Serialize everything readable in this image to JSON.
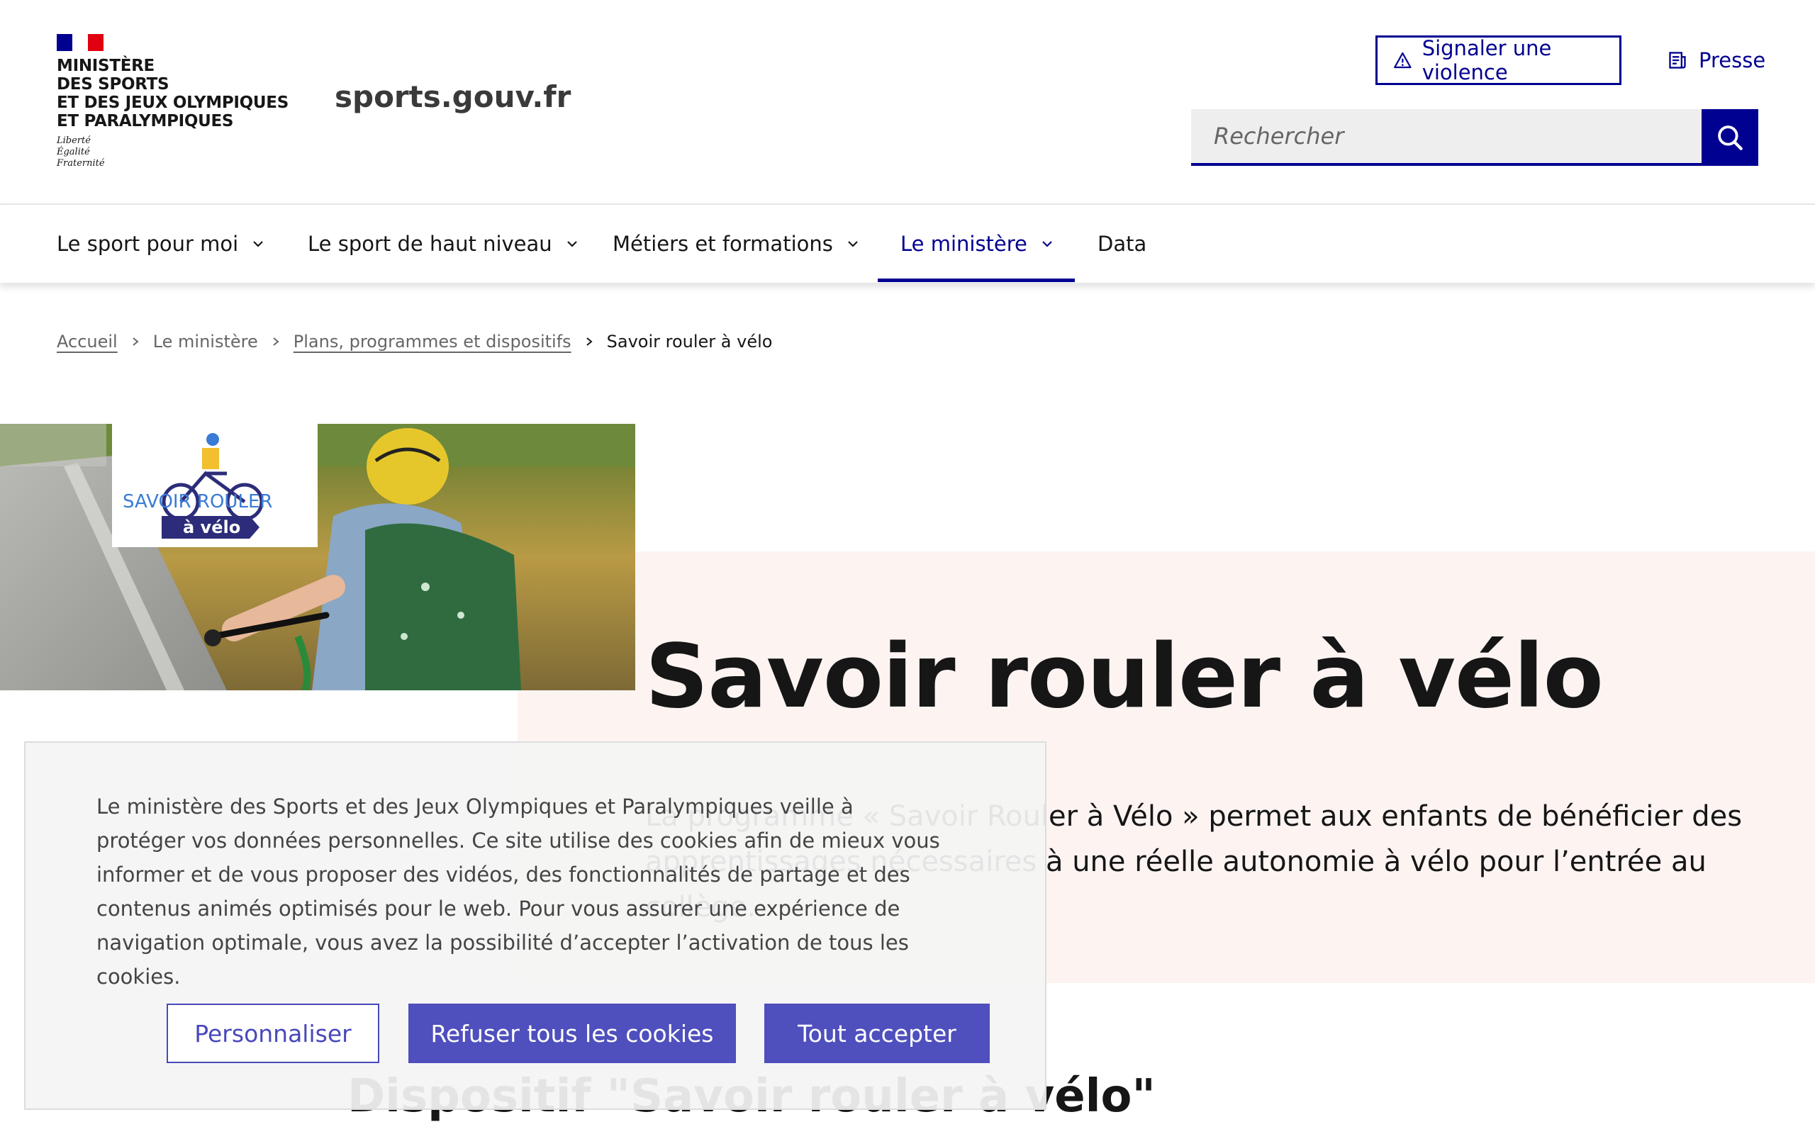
{
  "header": {
    "ministry_lines": [
      "MINISTÈRE",
      "DES SPORTS",
      "ET DES JEUX OLYMPIQUES",
      "ET PARALYMPIQUES"
    ],
    "motto_lines": [
      "Liberté",
      "Égalité",
      "Fraternité"
    ],
    "site_name": "sports.gouv.fr",
    "violence_button": "Signaler une violence",
    "presse_link": "Presse",
    "search": {
      "placeholder": "Rechercher"
    },
    "flag_colors": [
      "#000091",
      "#ffffff",
      "#e1000f"
    ]
  },
  "nav": {
    "items": [
      {
        "label": "Le sport pour moi",
        "has_menu": true,
        "active": false
      },
      {
        "label": "Le sport de haut niveau",
        "has_menu": true,
        "active": false
      },
      {
        "label": "Métiers et formations",
        "has_menu": true,
        "active": false
      },
      {
        "label": "Le ministère",
        "has_menu": true,
        "active": true
      },
      {
        "label": "Data",
        "has_menu": false,
        "active": false
      }
    ]
  },
  "breadcrumb": {
    "items": [
      "Accueil",
      "Le ministère",
      "Plans, programmes et dispositifs"
    ],
    "current": "Savoir rouler à vélo"
  },
  "hero": {
    "logo_text_top": "SAVOIR ROULER",
    "logo_text_bottom": "à vélo",
    "title": "Savoir rouler à vélo",
    "text": "La programme « Savoir Rouler à Vélo » permet aux enfants de bénéficier des apprentissages nécessaires à une réelle autonomie à vélo pour l’entrée au collège."
  },
  "section": {
    "title": "Dispositif \"Savoir rouler à vélo\""
  },
  "cookie_banner": {
    "text": "Le ministère des Sports et des Jeux Olympiques et Paralympiques veille à protéger vos données personnelles. Ce site utilise des cookies afin de mieux vous informer et de vous proposer des vidéos, des fonctionnalités de partage et des contenus animés optimisés pour le web. Pour vous assurer une expérience de navigation optimale, vous avez la possibilité d’accepter l’activation de tous les cookies.",
    "personalize_button": "Personnaliser",
    "refuse_button": "Refuser tous les cookies",
    "accept_button": "Tout accepter"
  },
  "colors": {
    "brand_blue": "#000091",
    "hero_band": "#fdf4f2",
    "cookie_button": "#4f4fbd"
  }
}
